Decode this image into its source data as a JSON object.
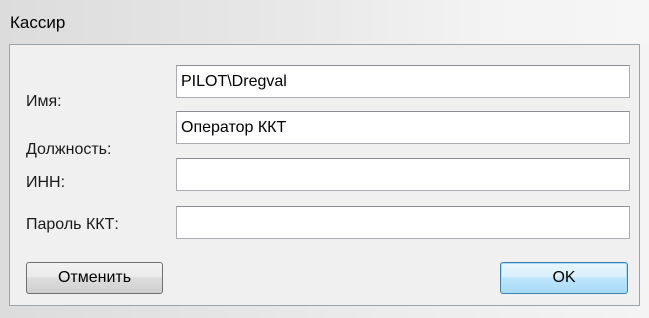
{
  "window": {
    "title": "Кассир"
  },
  "form": {
    "fields": [
      {
        "label": "Имя:",
        "value": "PILOT\\Dregval",
        "placeholder": ""
      },
      {
        "label": "Должность:",
        "value": "Оператор ККТ",
        "placeholder": ""
      },
      {
        "label": "ИНН:",
        "value": "",
        "placeholder": ""
      },
      {
        "label": "Пароль ККТ:",
        "value": "",
        "placeholder": ""
      }
    ]
  },
  "buttons": {
    "cancel_label": "Отменить",
    "ok_label": "OK"
  }
}
